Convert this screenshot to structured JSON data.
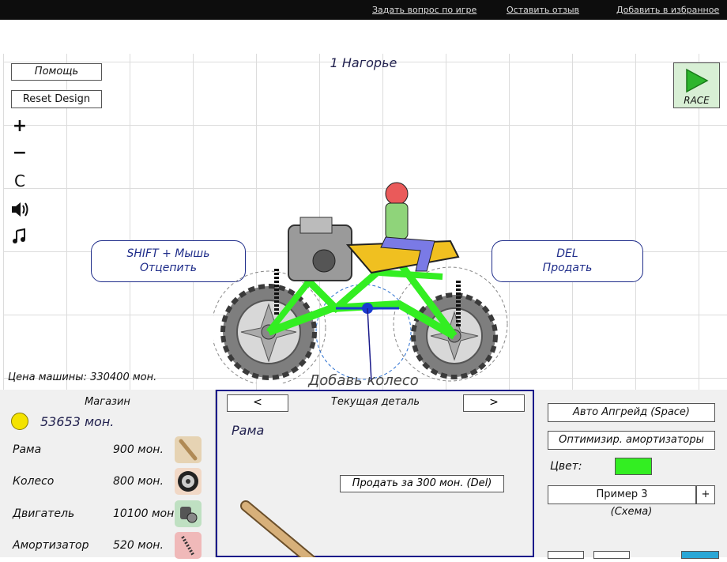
{
  "top_links": [
    "Задать вопрос по игре",
    "Оставить отзыв",
    "Добавить в избранное"
  ],
  "level_title": "1 Нагорье",
  "buttons": {
    "help": "Помощь",
    "reset": "Reset Design",
    "race": "RACE"
  },
  "side_icons": [
    {
      "name": "zoom-in-icon",
      "glyph": "+"
    },
    {
      "name": "zoom-out-icon",
      "glyph": "−"
    },
    {
      "name": "center-view-icon",
      "glyph": "C"
    },
    {
      "name": "sound-icon",
      "glyph": "🔊"
    },
    {
      "name": "music-icon",
      "glyph": "♫"
    }
  ],
  "hints": {
    "detach_line1": "SHIFT + Мышь",
    "detach_line2": "Отцепить",
    "sell_line1": "DEL",
    "sell_line2": "Продать"
  },
  "car_price": "Цена машины: 330400 мон.",
  "add_wheel": "Добавь колесо",
  "shop": {
    "title": "Магазин",
    "money": "53653 мон.",
    "items": [
      {
        "name": "Рама",
        "price": "900 мон.",
        "icon": "frame-part-icon",
        "color": "#e6d3b3"
      },
      {
        "name": "Колесо",
        "price": "800 мон.",
        "icon": "wheel-part-icon",
        "color": "#f1d8c6"
      },
      {
        "name": "Двигатель",
        "price": "10100 мон.",
        "icon": "engine-part-icon",
        "color": "#bfe0c2"
      },
      {
        "name": "Амортизатор",
        "price": "520 мон.",
        "icon": "shock-absorber-part-icon",
        "color": "#f0b9b9"
      }
    ]
  },
  "current_part": {
    "title": "Текущая деталь",
    "prev": "<",
    "next": ">",
    "name": "Рама",
    "sell": "Продать за  300 мон. (Del)"
  },
  "right_panel": {
    "auto_upgrade": "Авто Апгрейд (Space)",
    "optimize": "Оптимизир. амортизаторы",
    "color_label": "Цвет:",
    "color_value": "#33ee22",
    "example": "Пример 3",
    "plus": "+",
    "scheme": "(Схема)"
  },
  "colors": {
    "accent_blue": "#1f2d8a",
    "frame_green": "#33ee22",
    "helmet": "#ea5a5a"
  }
}
